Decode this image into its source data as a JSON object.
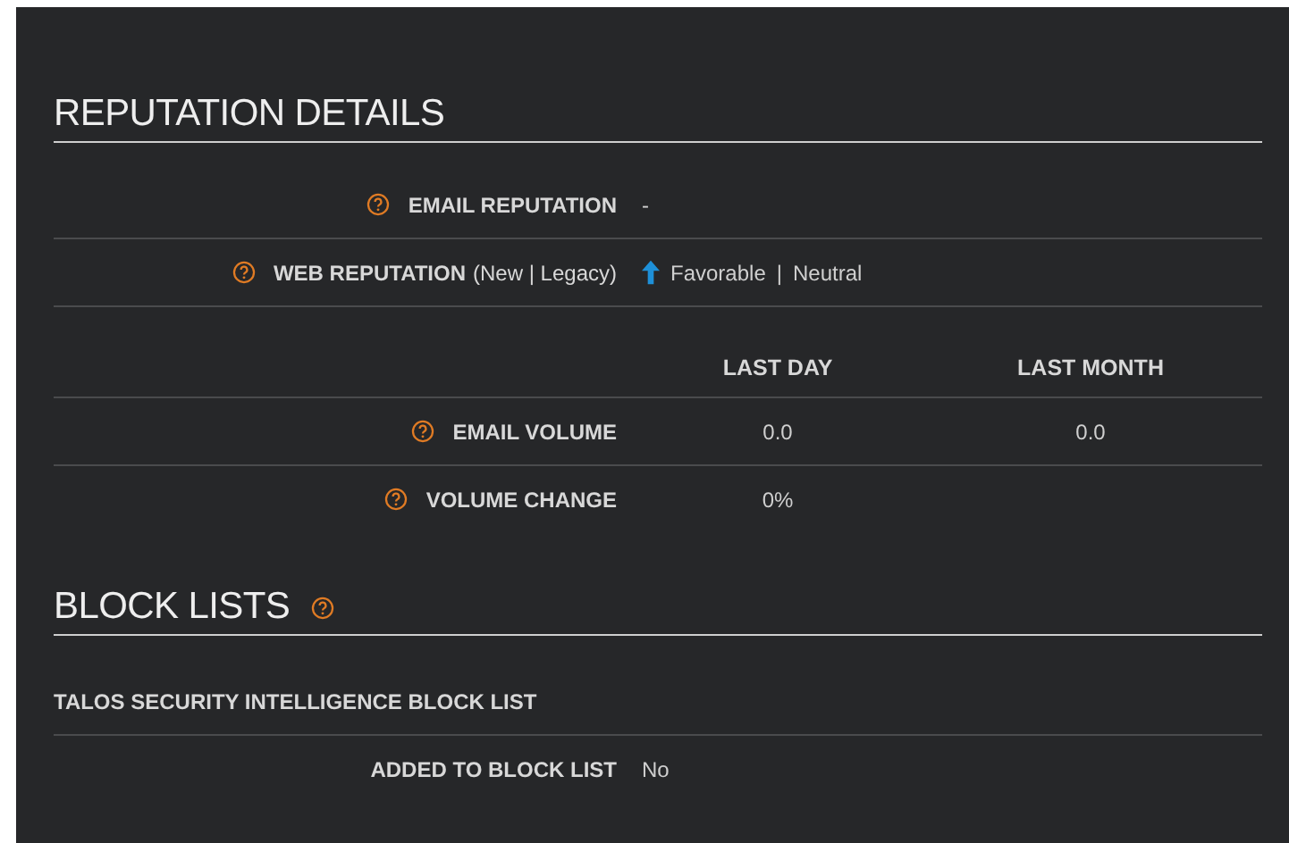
{
  "reputation": {
    "title": "REPUTATION DETAILS",
    "rows": [
      {
        "label": "EMAIL REPUTATION",
        "help": true,
        "values": [
          "-"
        ]
      },
      {
        "label": "WEB REPUTATION",
        "note": "(New | Legacy)",
        "help": true,
        "up_arrow": true,
        "values": [
          "Favorable",
          "|",
          "Neutral"
        ]
      }
    ]
  },
  "volume": {
    "columns": [
      "LAST DAY",
      "LAST MONTH"
    ],
    "rows": [
      {
        "label": "EMAIL VOLUME",
        "help": true,
        "cells": [
          "0.0",
          "0.0"
        ]
      },
      {
        "label": "VOLUME CHANGE",
        "help": true,
        "cells": [
          "0%"
        ]
      }
    ]
  },
  "block_lists": {
    "title": "BLOCK LISTS",
    "help": true,
    "list_title": "TALOS SECURITY INTELLIGENCE BLOCK LIST",
    "rows": [
      {
        "label": "ADDED TO BLOCK LIST",
        "help": false,
        "values": [
          "No"
        ]
      }
    ]
  }
}
